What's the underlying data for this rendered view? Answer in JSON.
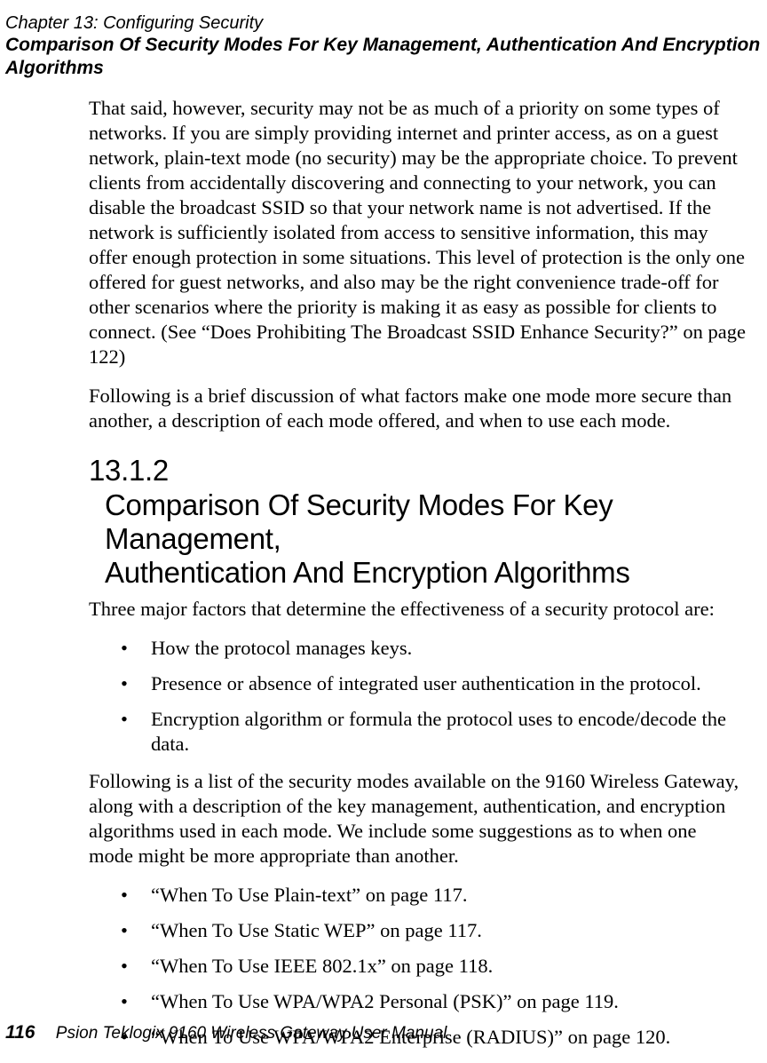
{
  "header": {
    "chapter_line": "Chapter 13:  Configuring Security",
    "section_line": "Comparison Of Security Modes For Key Management, Authentication And Encryption Algorithms"
  },
  "paragraphs": {
    "p1": "That said, however, security may not be as much of a priority on some types of networks. If you are simply providing internet and printer access, as on a guest net­work, plain-text mode (no security) may be the appropriate choice. To prevent clients from accidentally discovering and connecting to your network, you can disable the broadcast SSID so that your network name is not advertised. If the network is sufficiently isolated from access to sensitive information, this may offer enough protection in some situations. This level of protection is the only one offered for guest networks, and also may be the right convenience trade-off for other scenar­ios where the priority is making it as easy as possible for clients to connect. (See “Does Prohibiting The Broadcast SSID Enhance Security?” on page 122)",
    "p2": "Following is a brief discussion of what factors make one mode more secure than another, a description of each mode offered, and when to use each mode.",
    "p3": "Three major factors that determine the effectiveness of a security protocol are:",
    "p4": "Following is a list of the security modes available on the 9160 Wireless Gateway, along with a description of the key management, authentication, and encryption algorithms used in each mode. We include some suggestions as to when one mode might be more appropriate than another."
  },
  "section": {
    "number": "13.1.2",
    "title_line1": "Comparison Of Security Modes For Key Management,",
    "title_line2": "Authentication And Encryption Algorithms"
  },
  "bullets1": [
    "How the protocol manages keys.",
    "Presence or absence of integrated user authentication in the protocol.",
    "Encryption algorithm or formula the protocol uses to encode/decode the data."
  ],
  "bullets2": [
    "“When To Use Plain-text” on page 117.",
    "“When To Use Static WEP” on page 117.",
    "“When To Use IEEE 802.1x” on page 118.",
    "“When To Use WPA/WPA2 Personal (PSK)” on page 119.",
    "“When To Use WPA/WPA2 Enterprise (RADIUS)” on page 120."
  ],
  "footer": {
    "page_number": "116",
    "manual_title": "Psion Teklogix 9160 Wireless Gateway User Manual"
  }
}
